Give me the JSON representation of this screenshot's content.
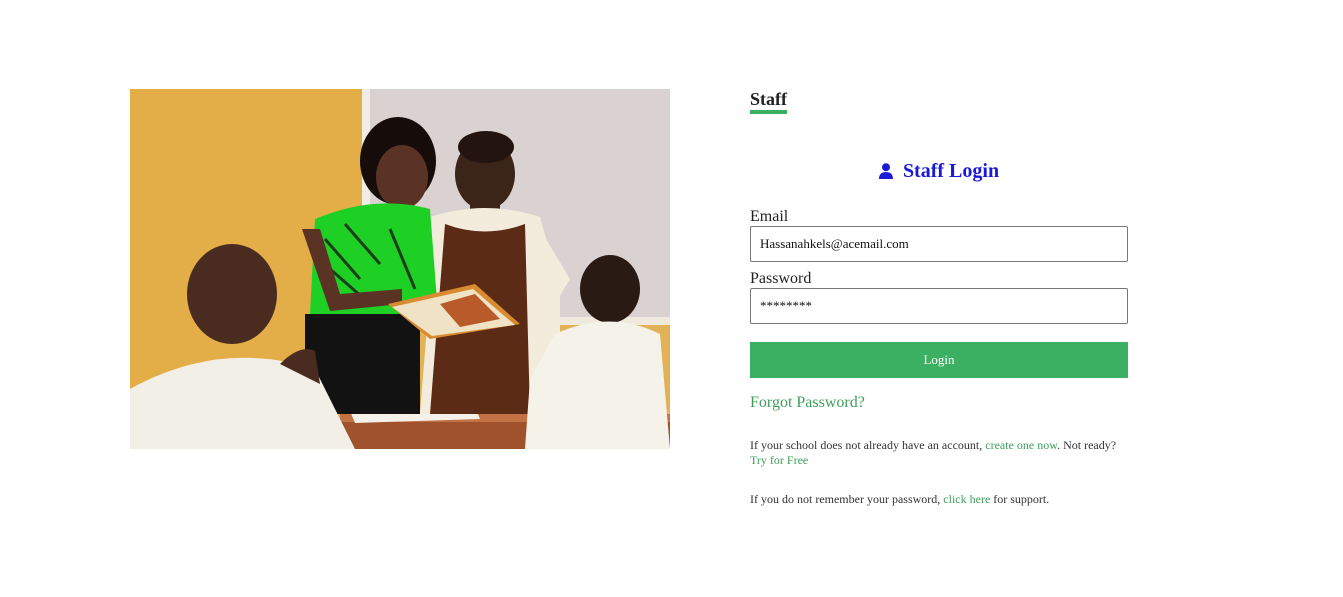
{
  "hero": {
    "alt": "Teacher reading a book with students in a classroom"
  },
  "tab": {
    "label": "Staff"
  },
  "login": {
    "heading": "Staff Login",
    "email_label": "Email",
    "email_value": "Hassanahkels@acemail.com",
    "password_label": "Password",
    "password_value": "********",
    "button_label": "Login",
    "forgot_label": "Forgot Password?"
  },
  "notes": {
    "account_prefix": "If your school does not already have an account, ",
    "create_link": "create one now",
    "account_middle": ". Not ready? ",
    "trial_link": "Try for Free",
    "password_prefix": "If you do not remember your password, ",
    "support_link": "click here",
    "password_suffix": " for support."
  },
  "colors": {
    "accent_green": "#3cb062",
    "link_green": "#3d9e5a",
    "heading_blue": "#1a1ad6"
  },
  "icons": {
    "heading_icon": "user-icon"
  }
}
